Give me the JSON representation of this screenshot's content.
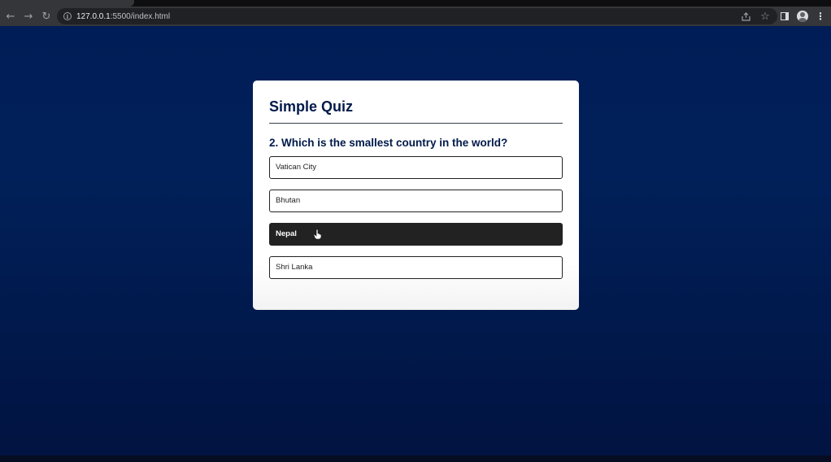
{
  "browser": {
    "url_host": "127.0.0.1",
    "url_rest": ":5500/index.html"
  },
  "quiz": {
    "title": "Simple Quiz",
    "question": "2. Which is the smallest country in the world?",
    "answers": [
      "Vatican City",
      "Bhutan",
      "Nepal",
      "Shri Lanka"
    ],
    "hovered_answer": "Nepal"
  },
  "colors": {
    "page_background": "#011d57",
    "title_color": "#001a4a",
    "hover_background": "#222222"
  }
}
